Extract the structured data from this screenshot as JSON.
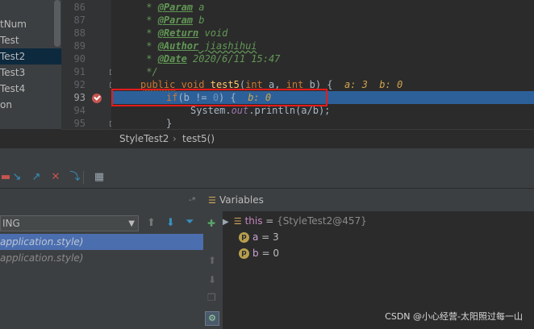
{
  "project": {
    "items": [
      {
        "label": "tNum",
        "selected": false
      },
      {
        "label": "Test",
        "selected": false
      },
      {
        "label": "Test2",
        "selected": true
      },
      {
        "label": "Test3",
        "selected": false
      },
      {
        "label": "Test4",
        "selected": false
      },
      {
        "label": "on",
        "selected": false
      }
    ]
  },
  "editor": {
    "line_numbers": [
      "86",
      "87",
      "88",
      "89",
      "90",
      "91",
      "92",
      "93",
      "94",
      "95"
    ],
    "lines": {
      "l86_star": " * ",
      "l86_tag": "@Param",
      "l86_rest": " a",
      "l87_star": " * ",
      "l87_tag": "@Param",
      "l87_rest": " b",
      "l88_star": " * ",
      "l88_tag": "@Return",
      "l88_rest": " void",
      "l89_star": " * ",
      "l89_tag": "@Author",
      "l89_rest": " jiashihui",
      "l90_star": " * ",
      "l90_tag": "@Date",
      "l90_rest": " 2020/6/11 15:47",
      "l91": " */",
      "l92_kw1": "public",
      "l92_kw2": "void",
      "l92_fn": "test5",
      "l92_p1": "(",
      "l92_kw3": "int",
      "l92_p2": " a, ",
      "l92_kw4": "int",
      "l92_p3": " b) {",
      "l92_inline": "a: 3  b: 0",
      "l93_kw": "if",
      "l93_p1": "(b != ",
      "l93_num": "0",
      "l93_p2": ") {",
      "l93_inline": "b: 0",
      "l94_p1": "System.",
      "l94_field": "out",
      "l94_p2": ".println(a/b);",
      "l95": "}"
    }
  },
  "breadcrumb": {
    "items": [
      "StyleTest2",
      "test5()"
    ],
    "separator": "›"
  },
  "debug": {
    "frames": {
      "thread_label": "ING",
      "rows": [
        {
          "label": "application.style)",
          "selected": true
        },
        {
          "label": "application.style)",
          "selected": false
        }
      ]
    },
    "variables": {
      "title": "Variables",
      "pin_label": "-*",
      "rows": [
        {
          "name": "this",
          "eq": " = ",
          "value": "{StyleTest2@457}"
        },
        {
          "badge": "p",
          "name": "a",
          "eq": " = ",
          "value": "3"
        },
        {
          "badge": "p",
          "name": "b",
          "eq": " = ",
          "value": "0"
        }
      ]
    }
  },
  "watermark": "CSDN @小心经营-太阳照过每一山",
  "colors": {
    "exec_line": "#2d6099",
    "highlight_box": "#e51b1b",
    "breakpoint": "#c75450"
  }
}
